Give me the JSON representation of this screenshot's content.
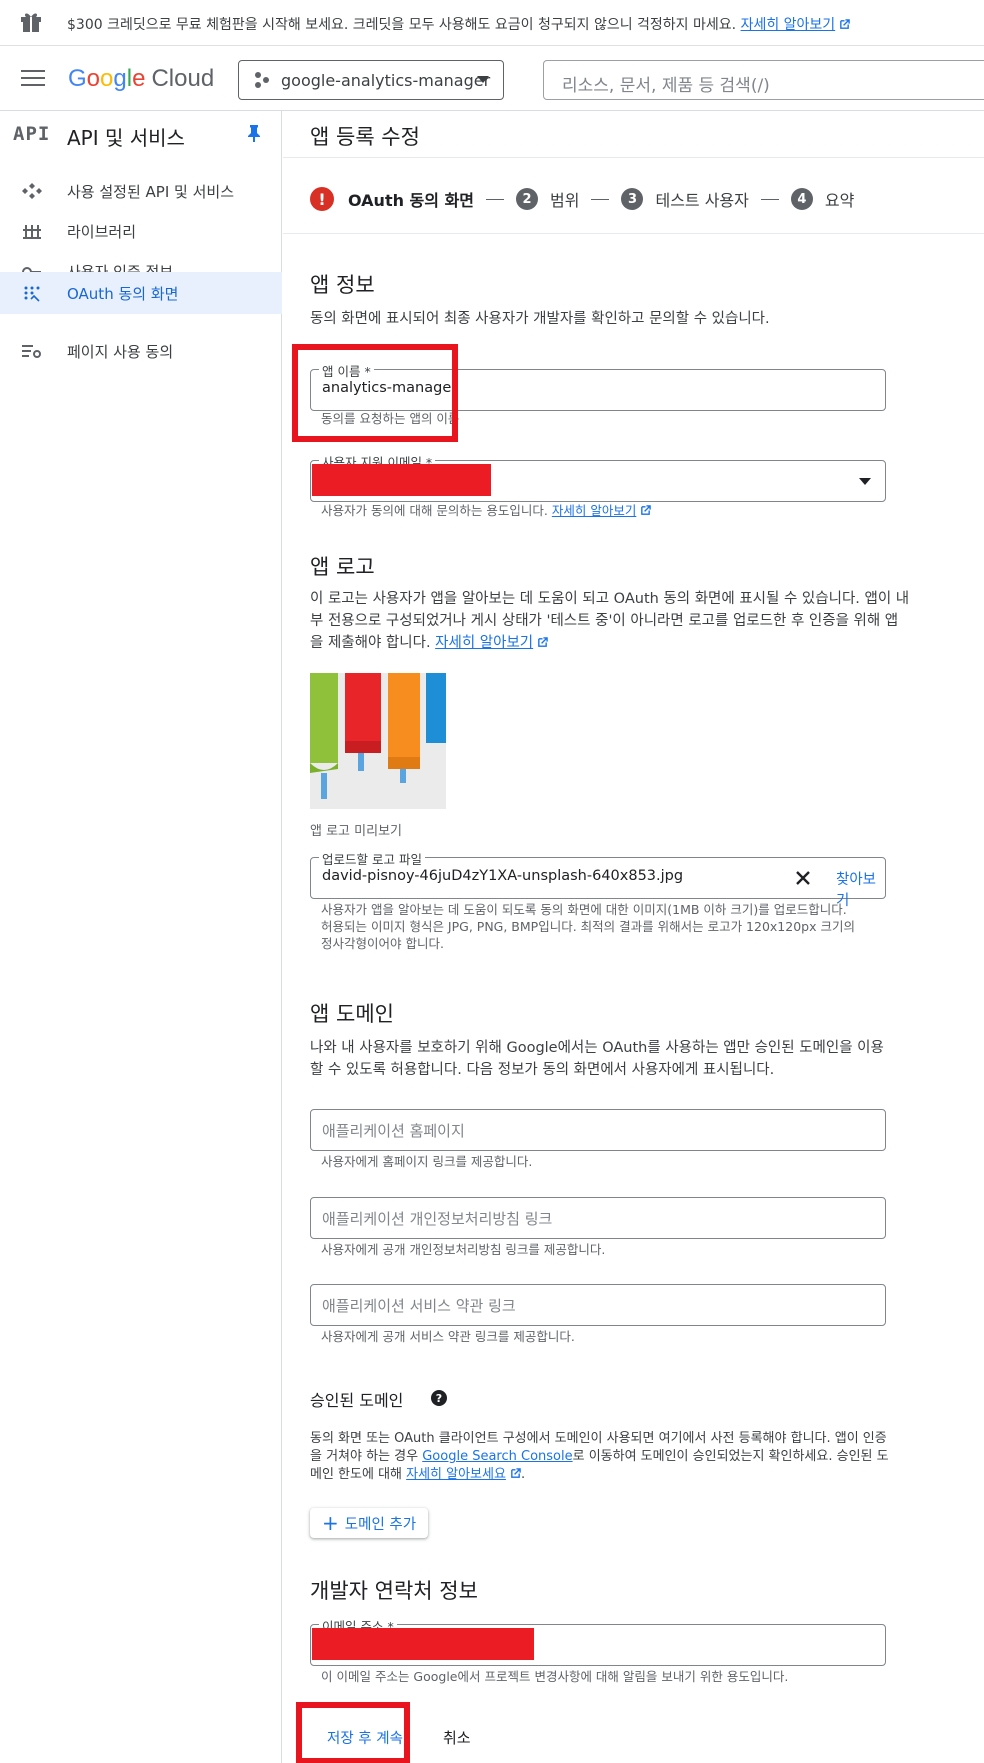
{
  "banner": {
    "text": "$300 크레딧으로 무료 체험판을 시작해 보세요. 크레딧을 모두 사용해도 요금이 청구되지 않으니 걱정하지 마세요.",
    "link": "자세히 알아보기"
  },
  "topbar": {
    "logo_google": "Google",
    "logo_cloud": "Cloud",
    "project": "google-analytics-manager",
    "search_placeholder": "리소스, 문서, 제품 등 검색(/)"
  },
  "sidebar": {
    "icon_text": "API",
    "title": "API 및 서비스",
    "items": [
      {
        "label": "사용 설정된 API 및 서비스",
        "icon": "hub-icon"
      },
      {
        "label": "라이브러리",
        "icon": "library-icon"
      },
      {
        "label": "사용자 인증 정보",
        "icon": "key-icon"
      },
      {
        "label": "OAuth 동의 화면",
        "icon": "consent-icon",
        "active": true
      },
      {
        "label": "페이지 사용 동의",
        "icon": "settings-list-icon"
      }
    ]
  },
  "main": {
    "page_title": "앱 등록 수정",
    "steps": [
      {
        "marker": "!",
        "label": "OAuth 동의 화면",
        "state": "error"
      },
      {
        "marker": "2",
        "label": "범위"
      },
      {
        "marker": "3",
        "label": "테스트 사용자"
      },
      {
        "marker": "4",
        "label": "요약"
      }
    ],
    "app_info": {
      "heading": "앱 정보",
      "desc": "동의 화면에 표시되어 최종 사용자가 개발자를 확인하고 문의할 수 있습니다.",
      "app_name_label": "앱 이름 *",
      "app_name_value": "analytics-manager",
      "app_name_hint": "동의를 요청하는 앱의 이름",
      "email_label": "사용자 지원 이메일 *",
      "email_hint": "사용자가 동의에 대해 문의하는 용도입니다.",
      "email_hint_link": "자세히 알아보기"
    },
    "app_logo": {
      "heading": "앱 로고",
      "desc": "이 로고는 사용자가 앱을 알아보는 데 도움이 되고 OAuth 동의 화면에 표시될 수 있습니다. 앱이 내부 전용으로 구성되었거나 게시 상태가 '테스트 중'이 아니라면 로고를 업로드한 후 인증을 위해 앱을 제출해야 합니다.",
      "desc_link": "자세히 알아보기",
      "preview_caption": "앱 로고 미리보기",
      "upload_label": "업로드할 로고 파일",
      "upload_value": "david-pisnoy-46juD4zY1XA-unsplash-640x853.jpg",
      "browse": "찾아보기",
      "upload_hint": "사용자가 앱을 알아보는 데 도움이 되도록 동의 화면에 대한 이미지(1MB 이하 크기)를 업로드합니다. 허용되는 이미지 형식은 JPG, PNG, BMP입니다. 최적의 결과를 위해서는 로고가 120x120px 크기의 정사각형이어야 합니다."
    },
    "app_domain": {
      "heading": "앱 도메인",
      "desc": "나와 내 사용자를 보호하기 위해 Google에서는 OAuth를 사용하는 앱만 승인된 도메인을 이용할 수 있도록 허용합니다. 다음 정보가 동의 화면에서 사용자에게 표시됩니다.",
      "homepage_placeholder": "애플리케이션 홈페이지",
      "homepage_hint": "사용자에게 홈페이지 링크를 제공합니다.",
      "privacy_placeholder": "애플리케이션 개인정보처리방침 링크",
      "privacy_hint": "사용자에게 공개 개인정보처리방침 링크를 제공합니다.",
      "tos_placeholder": "애플리케이션 서비스 약관 링크",
      "tos_hint": "사용자에게 공개 서비스 약관 링크를 제공합니다."
    },
    "authorized_domains": {
      "heading": "승인된 도메인",
      "help": "?",
      "desc_1": "동의 화면 또는 OAuth 클라이언트 구성에서 도메인이 사용되면 여기에서 사전 등록해야 합니다. 앱이 인증을 거쳐야 하는 경우 ",
      "desc_link1": "Google Search Console",
      "desc_2": "로 이동하여 도메인이 승인되었는지 확인하세요. 승인된 도메인 한도에 대해 ",
      "desc_link2": "자세히 알아보세요",
      "desc_3": ".",
      "add_button": "도메인 추가",
      "add_plus": "+"
    },
    "developer_contact": {
      "heading": "개발자 연락처 정보",
      "email_label": "이메일 주소 *",
      "email_hint": "이 이메일 주소는 Google에서 프로젝트 변경사항에 대해 알림을 보내기 위한 용도입니다."
    },
    "actions": {
      "save": "저장 후 계속",
      "cancel": "취소"
    }
  },
  "colors": {
    "accent": "#1a73e8",
    "error": "#d93025",
    "annotation_red": "#e8151f"
  }
}
